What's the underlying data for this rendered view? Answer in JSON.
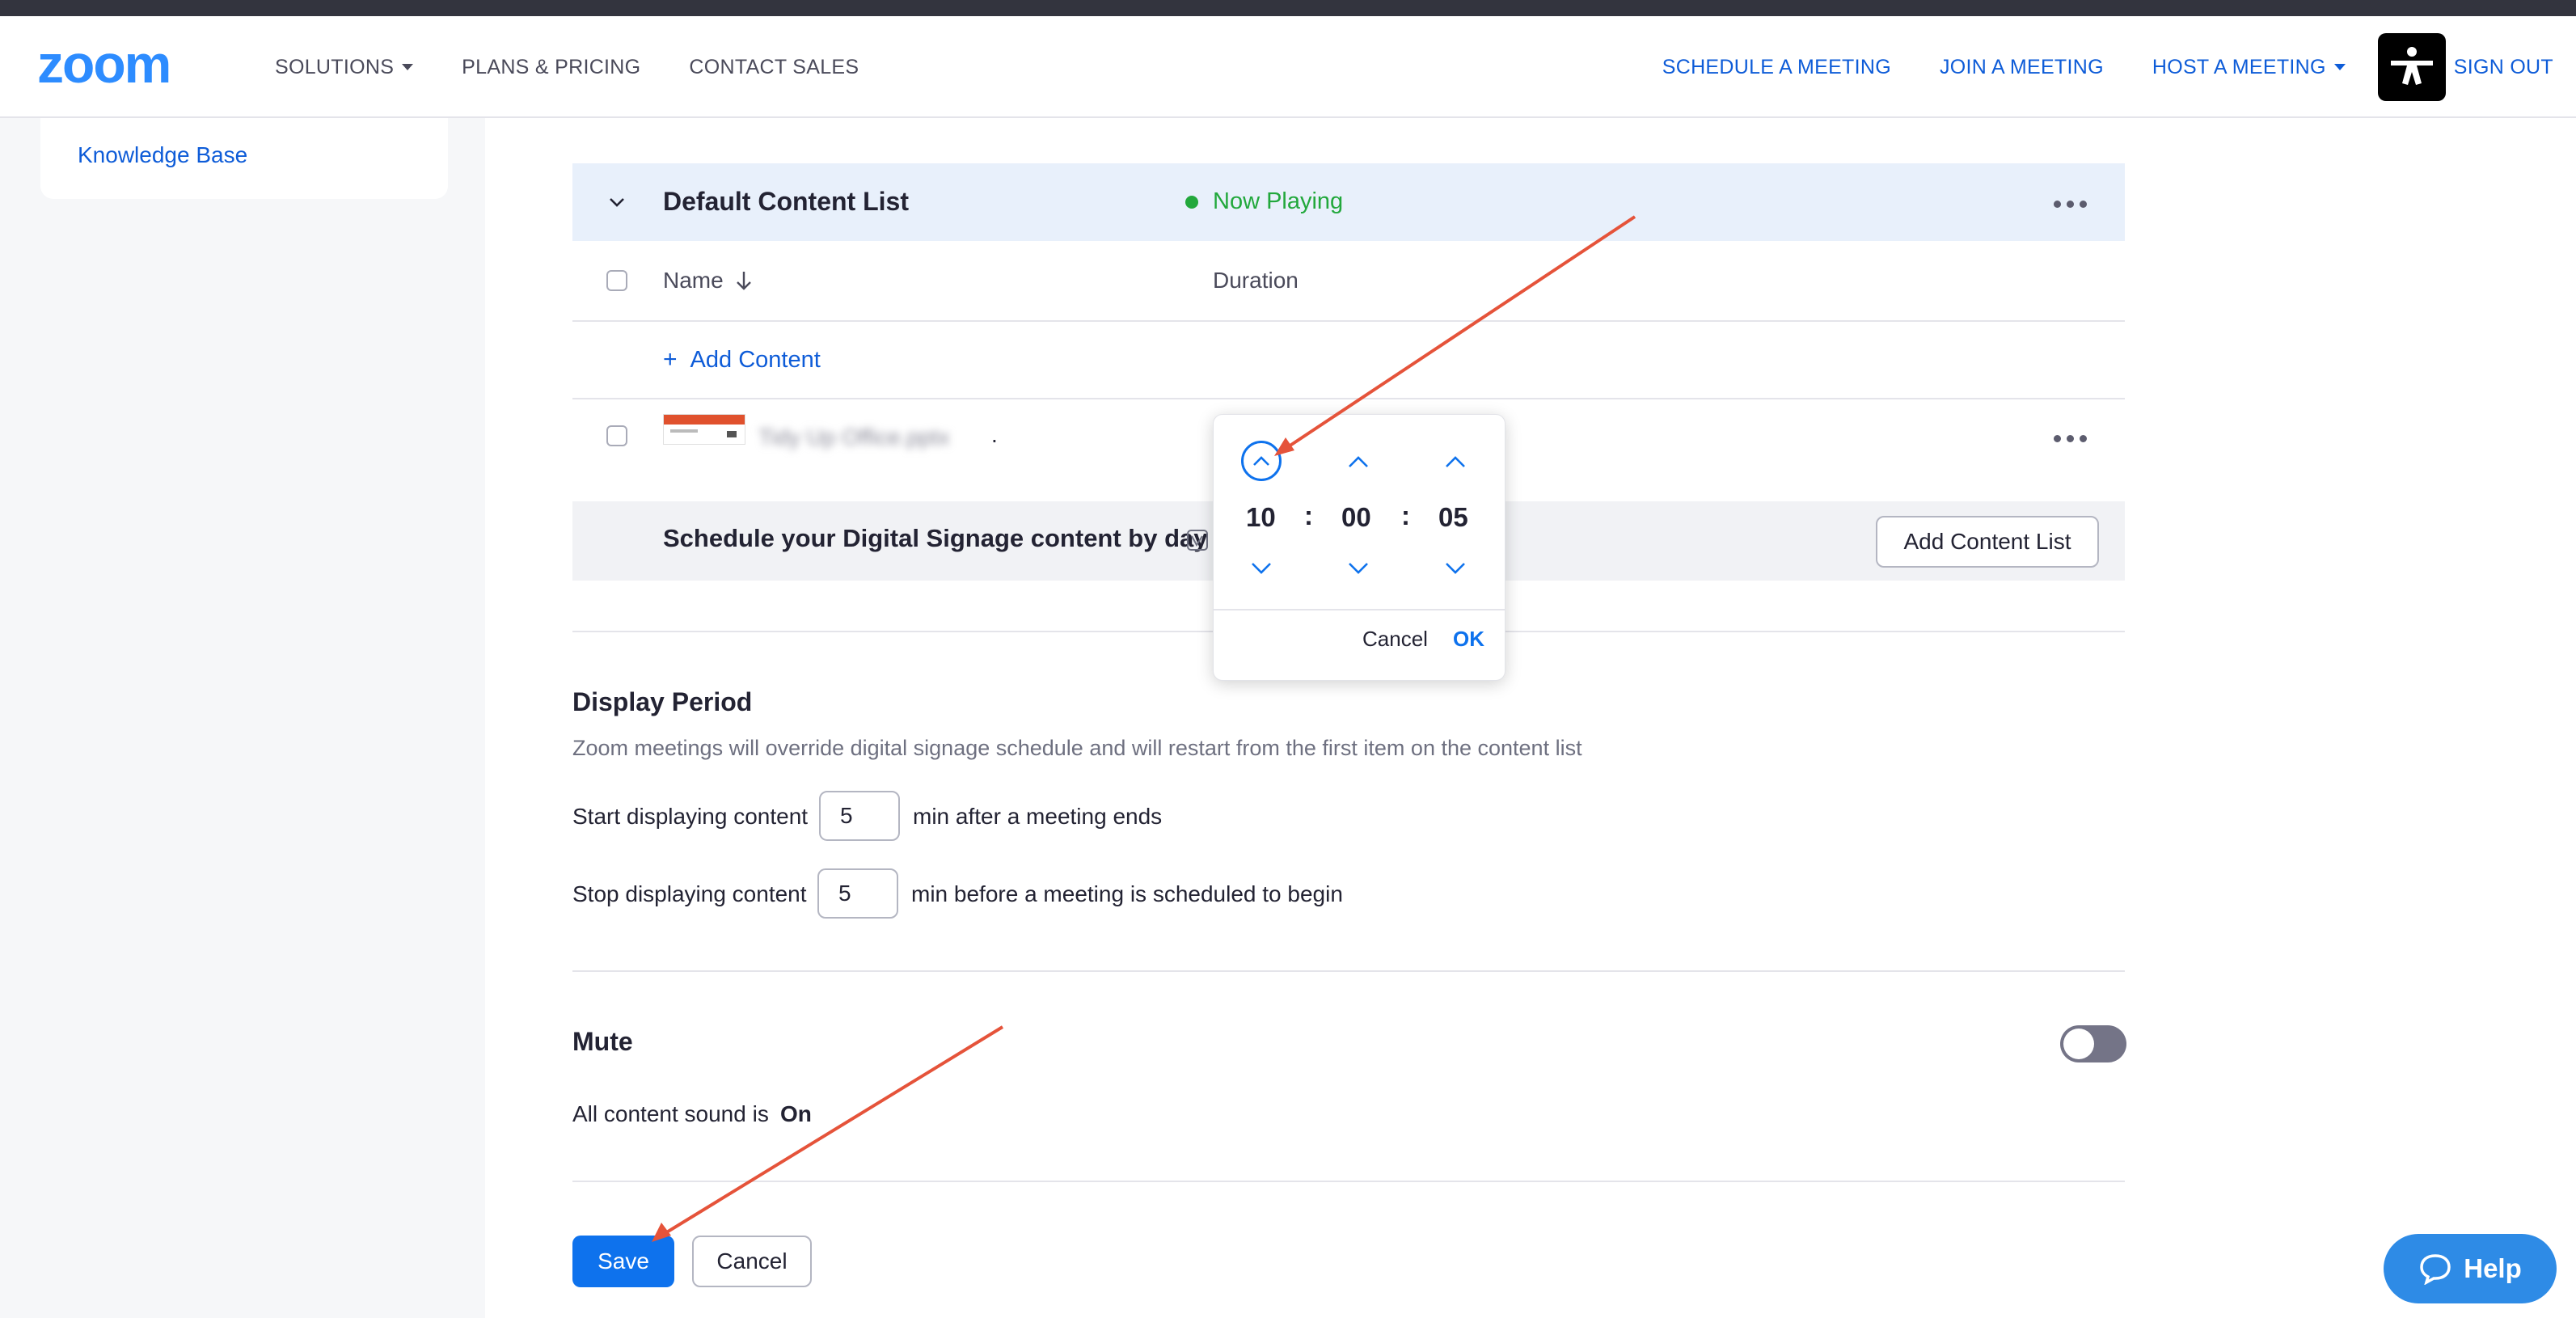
{
  "header": {
    "nav_left": {
      "solutions": "SOLUTIONS",
      "plans": "PLANS & PRICING",
      "contact": "CONTACT SALES"
    },
    "nav_right": {
      "schedule": "SCHEDULE A MEETING",
      "join": "JOIN A MEETING",
      "host": "HOST A MEETING",
      "signout": "SIGN OUT"
    }
  },
  "sidebar": {
    "knowledge_base": "Knowledge Base"
  },
  "content_list": {
    "title": "Default Content List",
    "status": "Now Playing",
    "columns": {
      "name": "Name",
      "duration": "Duration"
    },
    "add_content": "Add Content",
    "item_name_blurred": "Tidy Up Office.pptx",
    "item_suffix": "."
  },
  "schedule": {
    "label": "Schedule your Digital Signage content by day",
    "add_list_button": "Add Content List"
  },
  "time_picker": {
    "hours": "10",
    "minutes": "00",
    "seconds": "05",
    "separator": ":",
    "cancel": "Cancel",
    "ok": "OK"
  },
  "display_period": {
    "title": "Display Period",
    "description": "Zoom meetings will override digital signage schedule and will restart from the first item on the content list",
    "start_label": "Start displaying content",
    "start_value": "5",
    "start_suffix": "min after a meeting ends",
    "stop_label": "Stop displaying content",
    "stop_value": "5",
    "stop_suffix": "min before a meeting is scheduled to begin"
  },
  "mute": {
    "title": "Mute",
    "sound_label": "All content sound is",
    "sound_value": "On",
    "toggle_on": false
  },
  "actions": {
    "save": "Save",
    "cancel": "Cancel"
  },
  "help": {
    "label": "Help"
  },
  "colors": {
    "brand_blue": "#0e72ed",
    "link_blue": "#0e5cd8",
    "now_playing_green": "#22a83c",
    "annotation_arrow": "#e5533a"
  }
}
